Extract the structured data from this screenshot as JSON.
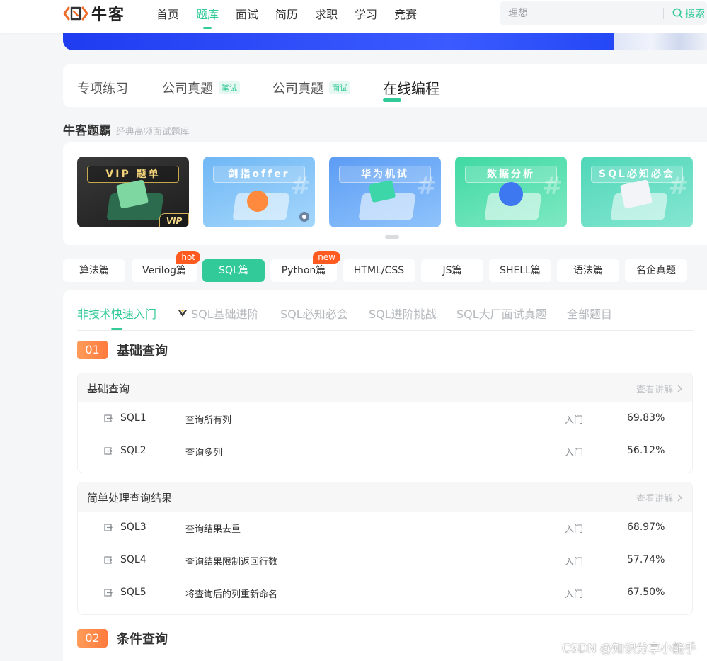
{
  "header": {
    "logo_text": "牛客",
    "nav": [
      "首页",
      "题库",
      "面试",
      "简历",
      "求职",
      "学习",
      "竞赛"
    ],
    "active_nav": "题库",
    "search": {
      "placeholder": "理想",
      "button": "搜索"
    }
  },
  "main_tabs": [
    {
      "label": "专项练习",
      "tag": ""
    },
    {
      "label": "公司真题",
      "tag": "笔试"
    },
    {
      "label": "公司真题",
      "tag": "面试"
    },
    {
      "label": "在线编程",
      "tag": ""
    }
  ],
  "section": {
    "title": "牛客题霸",
    "subtitle": "-经典高频面试题库"
  },
  "promos": [
    {
      "label": "VIP 题单",
      "badge": "VIP"
    },
    {
      "label": "剑指offer"
    },
    {
      "label": "华为机试"
    },
    {
      "label": "数据分析"
    },
    {
      "label": "SQL必知必会"
    }
  ],
  "categories": [
    {
      "label": "算法篇",
      "badge": ""
    },
    {
      "label": "Verilog篇",
      "badge": "hot"
    },
    {
      "label": "SQL篇",
      "badge": ""
    },
    {
      "label": "Python篇",
      "badge": "new"
    },
    {
      "label": "HTML/CSS",
      "badge": ""
    },
    {
      "label": "JS篇",
      "badge": ""
    },
    {
      "label": "SHELL篇",
      "badge": ""
    },
    {
      "label": "语法篇",
      "badge": ""
    },
    {
      "label": "名企真题",
      "badge": ""
    }
  ],
  "sub_tabs": [
    "非技术快速入门",
    "SQL基础进阶",
    "SQL必知必会",
    "SQL进阶挑战",
    "SQL大厂面试真题",
    "全部题目"
  ],
  "groups": [
    {
      "num": "01",
      "title": "基础查询",
      "boxes": [
        {
          "title": "基础查询",
          "link": "查看讲解",
          "rows": [
            {
              "id": "SQL1",
              "name": "查询所有列",
              "level": "入门",
              "rate": "69.83%"
            },
            {
              "id": "SQL2",
              "name": "查询多列",
              "level": "入门",
              "rate": "56.12%"
            }
          ]
        },
        {
          "title": "简单处理查询结果",
          "link": "查看讲解",
          "rows": [
            {
              "id": "SQL3",
              "name": "查询结果去重",
              "level": "入门",
              "rate": "68.97%"
            },
            {
              "id": "SQL4",
              "name": "查询结果限制返回行数",
              "level": "入门",
              "rate": "57.74%"
            },
            {
              "id": "SQL5",
              "name": "将查询后的列重新命名",
              "level": "入门",
              "rate": "67.50%"
            }
          ]
        }
      ]
    },
    {
      "num": "02",
      "title": "条件查询"
    }
  ],
  "watermark": "CSDN @知识分享小能手",
  "colors": {
    "accent": "#32ca99",
    "badge": "#ff5a1f",
    "group_num": "#ff8a47"
  }
}
